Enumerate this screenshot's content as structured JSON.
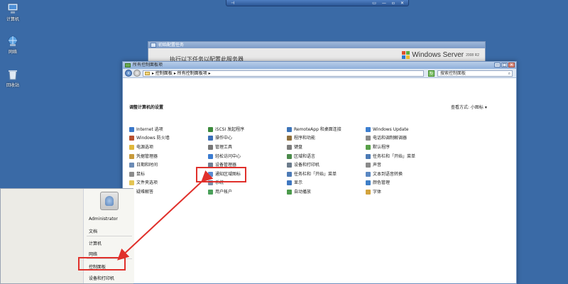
{
  "rdp_bar": {
    "pin_glyph": "⊣",
    "title": "",
    "controls": [
      "▭",
      "—",
      "▫",
      "✕"
    ]
  },
  "desktop_icons": [
    {
      "label": "计算机",
      "icon": "computer-icon"
    },
    {
      "label": "网络",
      "icon": "network-icon"
    },
    {
      "label": "回收站",
      "icon": "recycle-bin-icon"
    }
  ],
  "back_window": {
    "title": "初始配置任务",
    "task_text": "执行以下任务以配置此服务器",
    "logo_text": "Windows Server",
    "logo_version": "2008 R2"
  },
  "control_panel": {
    "title": "所有控制面板项",
    "window_buttons": [
      "—",
      "□",
      "✕"
    ],
    "address": "▸ 控制面板 ▸ 所有控制面板项 ▸",
    "search_placeholder": "搜索控制面板",
    "heading": "调整计算机的设置",
    "view_by": "查看方式: 小图标 ▾",
    "items": [
      {
        "label": "Internet 选项",
        "color": "#3b78c9"
      },
      {
        "label": "Windows 防火墙",
        "color": "#b8502f"
      },
      {
        "label": "电源选项",
        "color": "#e0b73a"
      },
      {
        "label": "凭据管理器",
        "color": "#c79a3b"
      },
      {
        "label": "日期和时间",
        "color": "#6b8bb5"
      },
      {
        "label": "鼠标",
        "color": "#8c8c8c"
      },
      {
        "label": "文件夹选项",
        "color": "#e3c454"
      },
      {
        "label": "疑难解答",
        "color": "#4a78b0"
      },
      {
        "label": "iSCSI 发起程序",
        "color": "#3c8a3c"
      },
      {
        "label": "操作中心",
        "color": "#3b6fb8"
      },
      {
        "label": "管理工具",
        "color": "#777777"
      },
      {
        "label": "轻松访问中心",
        "color": "#3a7bd0"
      },
      {
        "label": "设备管理器",
        "color": "#6f7f94"
      },
      {
        "label": "通知区域图标",
        "color": "#5a8ad1"
      },
      {
        "label": "系统",
        "color": "#7a8ea8"
      },
      {
        "label": "用户帐户",
        "color": "#4aa05a"
      },
      {
        "label": "RemoteApp 和桌面连接",
        "color": "#3d74b8"
      },
      {
        "label": "程序和功能",
        "color": "#8e6f3d"
      },
      {
        "label": "键盘",
        "color": "#7d7d7d"
      },
      {
        "label": "区域和语言",
        "color": "#4a8a4a"
      },
      {
        "label": "设备和打印机",
        "color": "#6b7b8b"
      },
      {
        "label": "任务栏和「开始」菜单",
        "color": "#4c7ab5"
      },
      {
        "label": "显示",
        "color": "#3f77c0"
      },
      {
        "label": "自动播放",
        "color": "#4b9a4b"
      },
      {
        "label": "Windows Update",
        "color": "#3d7fd0"
      },
      {
        "label": "电话和调制解调器",
        "color": "#8a8a8a"
      },
      {
        "label": "默认程序",
        "color": "#58a048"
      },
      {
        "label": "任务栏和「开始」菜单",
        "color": "#4c7ab5"
      },
      {
        "label": "声音",
        "color": "#8a8a8a"
      },
      {
        "label": "文本到语音转换",
        "color": "#5a88c2"
      },
      {
        "label": "颜色管理",
        "color": "#3e7fc7"
      },
      {
        "label": "字体",
        "color": "#d2a33d"
      }
    ]
  },
  "start_menu": {
    "user_name": "Administrator",
    "items": [
      "文档",
      "计算机",
      "网络",
      "控制面板",
      "设备和打印机"
    ]
  },
  "accent_red": "#e0302b"
}
